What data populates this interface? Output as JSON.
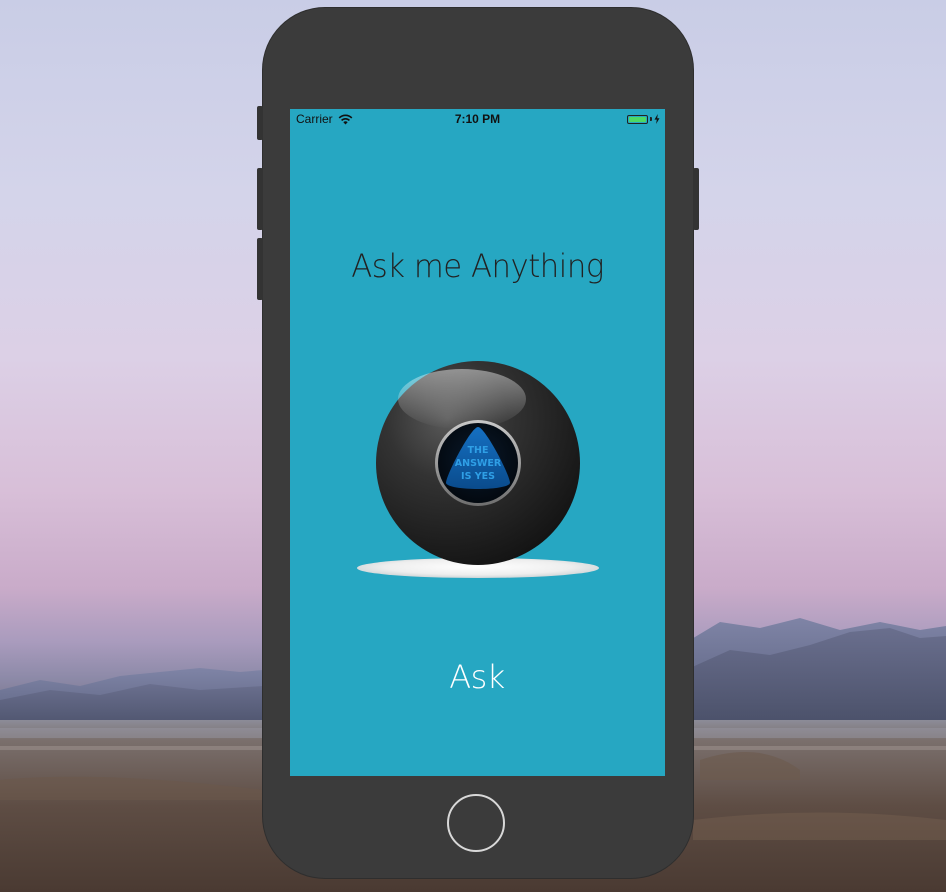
{
  "status_bar": {
    "carrier": "Carrier",
    "time": "7:10 PM",
    "wifi_icon": "wifi-icon",
    "battery_icon": "battery-icon",
    "charging_icon": "lightning-icon"
  },
  "app": {
    "title": "Ask me Anything",
    "ball_answer_lines": [
      "THE",
      "ANSWER",
      "IS YES"
    ],
    "ask_label": "Ask"
  },
  "colors": {
    "screen_background": "#26a7c2",
    "phone_body": "#3b3b3b",
    "ask_text": "#ffffff",
    "title_text": "#222222",
    "answer_triangle": "#0e5fa8",
    "answer_text": "#2f9fe6"
  }
}
